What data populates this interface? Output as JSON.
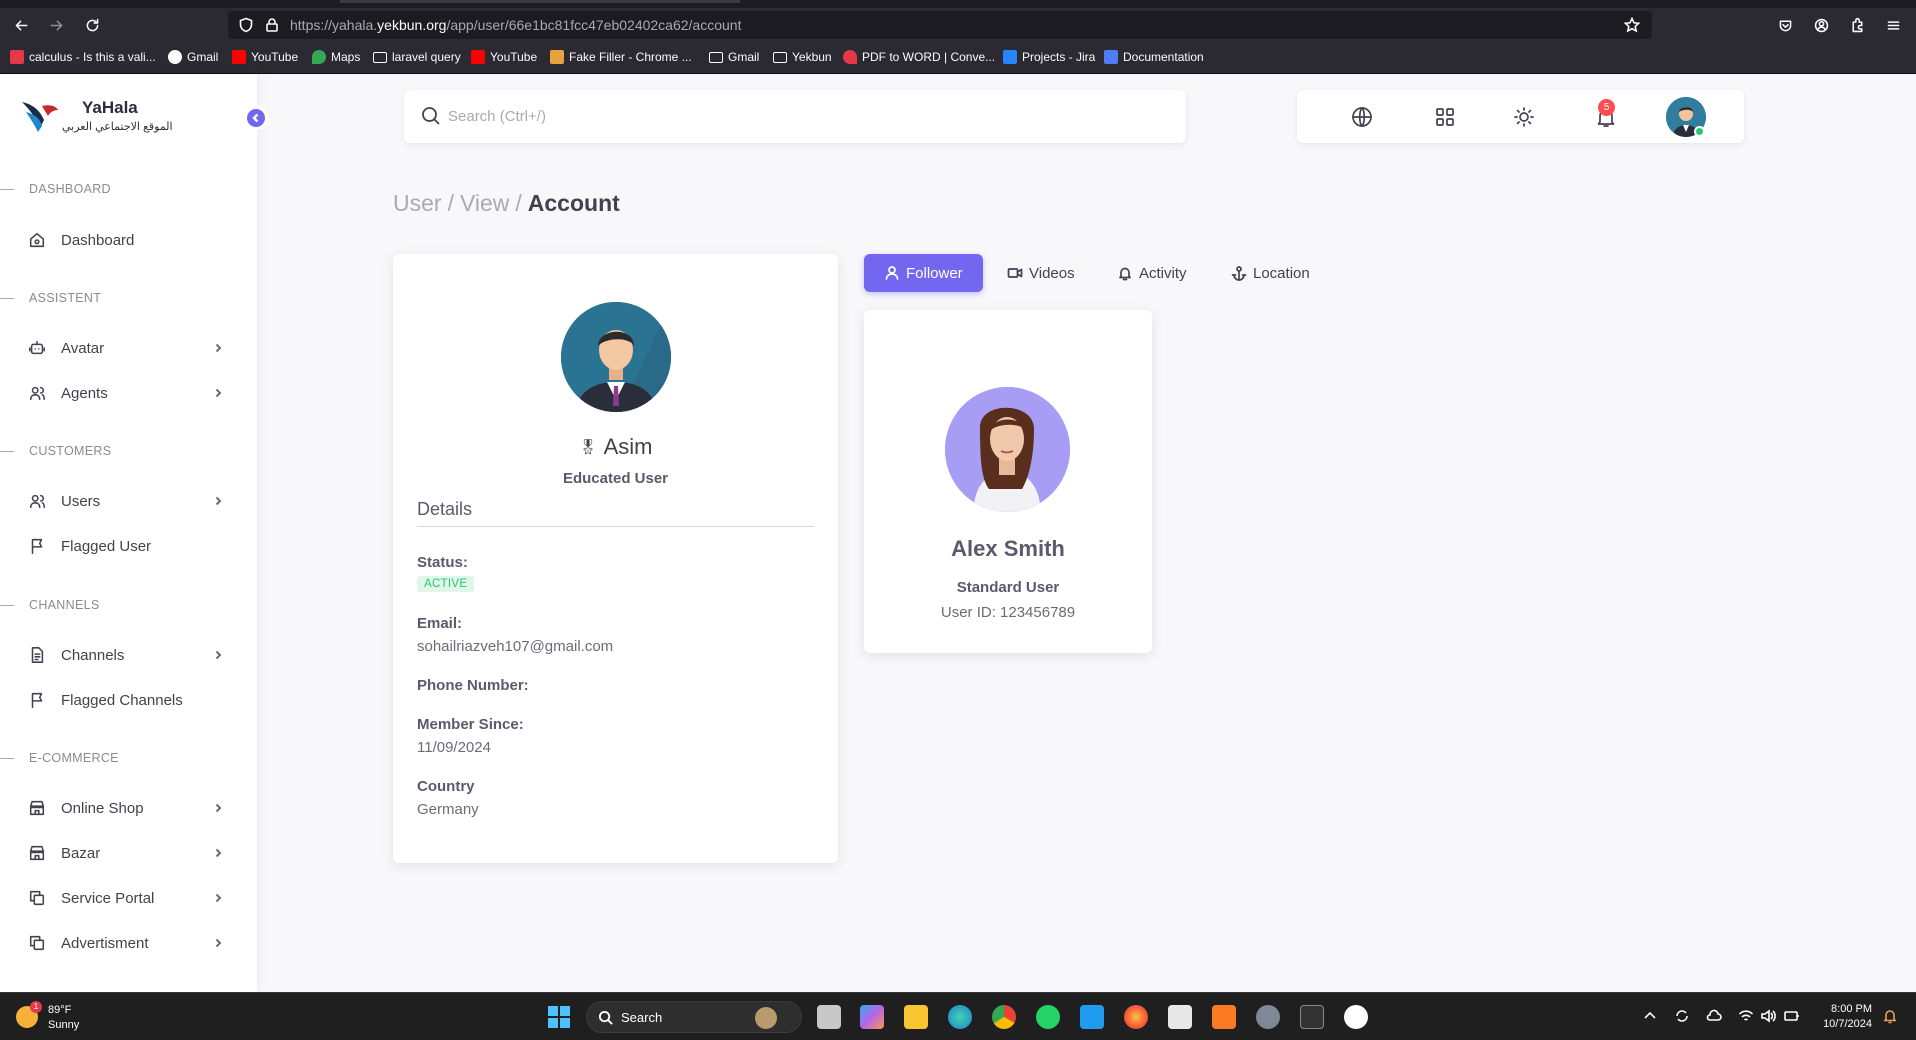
{
  "browser": {
    "url_prefix": "https://yahala.",
    "url_domain": "yekbun.org",
    "url_path": "/app/user/66e1bc81fcc47eb02402ca62/account",
    "bookmarks": [
      {
        "label": "calculus - Is this a vali...",
        "icon": "stackexchange-icon",
        "color": "#e5394a"
      },
      {
        "label": "Gmail",
        "icon": "google-icon",
        "color": "#ffffff"
      },
      {
        "label": "YouTube",
        "icon": "youtube-icon",
        "color": "#ff0000"
      },
      {
        "label": "Maps",
        "icon": "maps-icon",
        "color": "#34a853"
      },
      {
        "label": "laravel query",
        "icon": "folder-icon",
        "color": ""
      },
      {
        "label": "YouTube",
        "icon": "youtube-icon",
        "color": "#ff0000"
      },
      {
        "label": "Fake Filler - Chrome ...",
        "icon": "extension-icon",
        "color": "#e8a33d"
      },
      {
        "label": "Gmail",
        "icon": "folder-icon",
        "color": ""
      },
      {
        "label": "Yekbun",
        "icon": "folder-icon",
        "color": ""
      },
      {
        "label": "PDF to WORD | Conve...",
        "icon": "heart-icon",
        "color": "#e5394a"
      },
      {
        "label": "Projects - Jira",
        "icon": "jira-icon",
        "color": "#2684ff"
      },
      {
        "label": "Documentation",
        "icon": "doc-icon",
        "color": "#4f7cf7"
      }
    ]
  },
  "app": {
    "brand": "YaHala",
    "brand_subtitle": "الموقع الاجتماعي العربي",
    "accent": "#7367f0"
  },
  "sidebar": {
    "sections": [
      {
        "title": "DASHBOARD",
        "items": [
          {
            "label": "Dashboard",
            "icon": "home-icon",
            "chevron": false
          }
        ]
      },
      {
        "title": "ASSISTENT",
        "items": [
          {
            "label": "Avatar",
            "icon": "robot-icon",
            "chevron": true
          },
          {
            "label": "Agents",
            "icon": "users-icon",
            "chevron": true
          }
        ]
      },
      {
        "title": "CUSTOMERS",
        "items": [
          {
            "label": "Users",
            "icon": "users-icon",
            "chevron": true
          },
          {
            "label": "Flagged User",
            "icon": "flag-icon",
            "chevron": false
          }
        ]
      },
      {
        "title": "CHANNELS",
        "items": [
          {
            "label": "Channels",
            "icon": "file-icon",
            "chevron": true
          },
          {
            "label": "Flagged Channels",
            "icon": "flag-icon",
            "chevron": false
          }
        ]
      },
      {
        "title": "E-COMMERCE",
        "items": [
          {
            "label": "Online Shop",
            "icon": "store-icon",
            "chevron": true
          },
          {
            "label": "Bazar",
            "icon": "store-icon",
            "chevron": true
          },
          {
            "label": "Service Portal",
            "icon": "copy-icon",
            "chevron": true
          },
          {
            "label": "Advertisment",
            "icon": "copy-icon",
            "chevron": true
          }
        ]
      }
    ]
  },
  "header": {
    "search_placeholder": "Search (Ctrl+/)",
    "notification_count": "5"
  },
  "breadcrumb": {
    "part1": "User",
    "part2": "View",
    "current": "Account"
  },
  "profile": {
    "name": "Asim",
    "role": "Educated User",
    "details_title": "Details",
    "status_label": "Status:",
    "status_value": "ACTIVE",
    "email_label": "Email:",
    "email_value": "sohailriazveh107@gmail.com",
    "phone_label": "Phone Number:",
    "phone_value": "",
    "member_label": "Member Since:",
    "member_value": "11/09/2024",
    "country_label": "Country",
    "country_value": "Germany"
  },
  "tabs": [
    {
      "label": "Follower",
      "icon": "user-icon",
      "active": true
    },
    {
      "label": "Videos",
      "icon": "video-icon",
      "active": false
    },
    {
      "label": "Activity",
      "icon": "bell-icon",
      "active": false
    },
    {
      "label": "Location",
      "icon": "anchor-icon",
      "active": false
    }
  ],
  "follower": {
    "name": "Alex Smith",
    "role": "Standard User",
    "user_id": "User ID: 123456789"
  },
  "taskbar": {
    "temperature": "89°F",
    "condition": "Sunny",
    "weather_badge": "1",
    "search_label": "Search",
    "time": "8:00 PM",
    "date": "10/7/2024"
  }
}
